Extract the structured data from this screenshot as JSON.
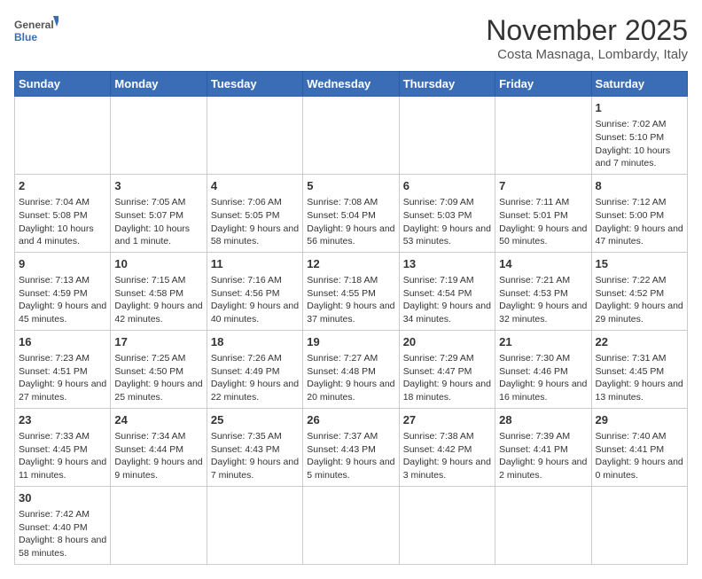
{
  "header": {
    "logo_general": "General",
    "logo_blue": "Blue",
    "month": "November 2025",
    "location": "Costa Masnaga, Lombardy, Italy"
  },
  "weekdays": [
    "Sunday",
    "Monday",
    "Tuesday",
    "Wednesday",
    "Thursday",
    "Friday",
    "Saturday"
  ],
  "weeks": [
    [
      {
        "day": "",
        "info": ""
      },
      {
        "day": "",
        "info": ""
      },
      {
        "day": "",
        "info": ""
      },
      {
        "day": "",
        "info": ""
      },
      {
        "day": "",
        "info": ""
      },
      {
        "day": "",
        "info": ""
      },
      {
        "day": "1",
        "info": "Sunrise: 7:02 AM\nSunset: 5:10 PM\nDaylight: 10 hours and 7 minutes."
      }
    ],
    [
      {
        "day": "2",
        "info": "Sunrise: 7:04 AM\nSunset: 5:08 PM\nDaylight: 10 hours and 4 minutes."
      },
      {
        "day": "3",
        "info": "Sunrise: 7:05 AM\nSunset: 5:07 PM\nDaylight: 10 hours and 1 minute."
      },
      {
        "day": "4",
        "info": "Sunrise: 7:06 AM\nSunset: 5:05 PM\nDaylight: 9 hours and 58 minutes."
      },
      {
        "day": "5",
        "info": "Sunrise: 7:08 AM\nSunset: 5:04 PM\nDaylight: 9 hours and 56 minutes."
      },
      {
        "day": "6",
        "info": "Sunrise: 7:09 AM\nSunset: 5:03 PM\nDaylight: 9 hours and 53 minutes."
      },
      {
        "day": "7",
        "info": "Sunrise: 7:11 AM\nSunset: 5:01 PM\nDaylight: 9 hours and 50 minutes."
      },
      {
        "day": "8",
        "info": "Sunrise: 7:12 AM\nSunset: 5:00 PM\nDaylight: 9 hours and 47 minutes."
      }
    ],
    [
      {
        "day": "9",
        "info": "Sunrise: 7:13 AM\nSunset: 4:59 PM\nDaylight: 9 hours and 45 minutes."
      },
      {
        "day": "10",
        "info": "Sunrise: 7:15 AM\nSunset: 4:58 PM\nDaylight: 9 hours and 42 minutes."
      },
      {
        "day": "11",
        "info": "Sunrise: 7:16 AM\nSunset: 4:56 PM\nDaylight: 9 hours and 40 minutes."
      },
      {
        "day": "12",
        "info": "Sunrise: 7:18 AM\nSunset: 4:55 PM\nDaylight: 9 hours and 37 minutes."
      },
      {
        "day": "13",
        "info": "Sunrise: 7:19 AM\nSunset: 4:54 PM\nDaylight: 9 hours and 34 minutes."
      },
      {
        "day": "14",
        "info": "Sunrise: 7:21 AM\nSunset: 4:53 PM\nDaylight: 9 hours and 32 minutes."
      },
      {
        "day": "15",
        "info": "Sunrise: 7:22 AM\nSunset: 4:52 PM\nDaylight: 9 hours and 29 minutes."
      }
    ],
    [
      {
        "day": "16",
        "info": "Sunrise: 7:23 AM\nSunset: 4:51 PM\nDaylight: 9 hours and 27 minutes."
      },
      {
        "day": "17",
        "info": "Sunrise: 7:25 AM\nSunset: 4:50 PM\nDaylight: 9 hours and 25 minutes."
      },
      {
        "day": "18",
        "info": "Sunrise: 7:26 AM\nSunset: 4:49 PM\nDaylight: 9 hours and 22 minutes."
      },
      {
        "day": "19",
        "info": "Sunrise: 7:27 AM\nSunset: 4:48 PM\nDaylight: 9 hours and 20 minutes."
      },
      {
        "day": "20",
        "info": "Sunrise: 7:29 AM\nSunset: 4:47 PM\nDaylight: 9 hours and 18 minutes."
      },
      {
        "day": "21",
        "info": "Sunrise: 7:30 AM\nSunset: 4:46 PM\nDaylight: 9 hours and 16 minutes."
      },
      {
        "day": "22",
        "info": "Sunrise: 7:31 AM\nSunset: 4:45 PM\nDaylight: 9 hours and 13 minutes."
      }
    ],
    [
      {
        "day": "23",
        "info": "Sunrise: 7:33 AM\nSunset: 4:45 PM\nDaylight: 9 hours and 11 minutes."
      },
      {
        "day": "24",
        "info": "Sunrise: 7:34 AM\nSunset: 4:44 PM\nDaylight: 9 hours and 9 minutes."
      },
      {
        "day": "25",
        "info": "Sunrise: 7:35 AM\nSunset: 4:43 PM\nDaylight: 9 hours and 7 minutes."
      },
      {
        "day": "26",
        "info": "Sunrise: 7:37 AM\nSunset: 4:43 PM\nDaylight: 9 hours and 5 minutes."
      },
      {
        "day": "27",
        "info": "Sunrise: 7:38 AM\nSunset: 4:42 PM\nDaylight: 9 hours and 3 minutes."
      },
      {
        "day": "28",
        "info": "Sunrise: 7:39 AM\nSunset: 4:41 PM\nDaylight: 9 hours and 2 minutes."
      },
      {
        "day": "29",
        "info": "Sunrise: 7:40 AM\nSunset: 4:41 PM\nDaylight: 9 hours and 0 minutes."
      }
    ],
    [
      {
        "day": "30",
        "info": "Sunrise: 7:42 AM\nSunset: 4:40 PM\nDaylight: 8 hours and 58 minutes."
      },
      {
        "day": "",
        "info": ""
      },
      {
        "day": "",
        "info": ""
      },
      {
        "day": "",
        "info": ""
      },
      {
        "day": "",
        "info": ""
      },
      {
        "day": "",
        "info": ""
      },
      {
        "day": "",
        "info": ""
      }
    ]
  ]
}
